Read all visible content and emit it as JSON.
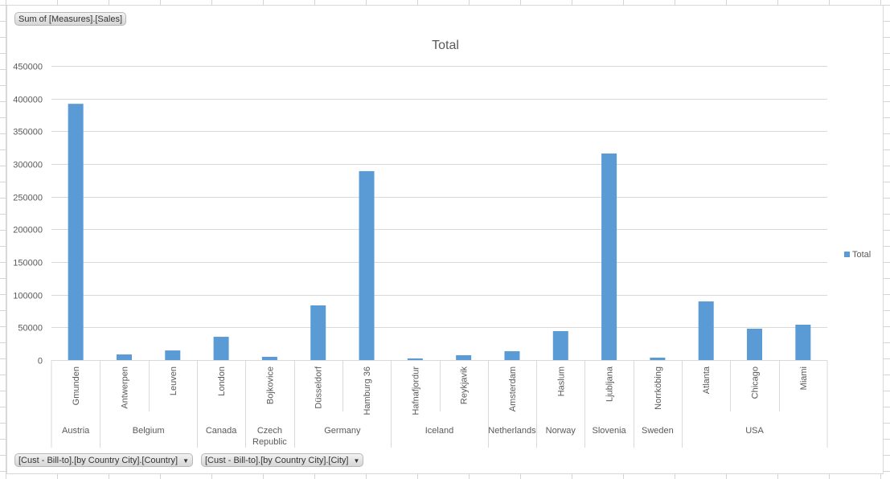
{
  "field_buttons": {
    "values": "Sum of [Measures].[Sales]",
    "axis_country": "[Cust - Bill-to].[by Country City].[Country]",
    "axis_city": "[Cust - Bill-to].[by Country City].[City]"
  },
  "icons": {
    "dropdown": "chevron-down-icon"
  },
  "colors": {
    "bar": "#5b9bd5",
    "grid": "#d9d9d9",
    "text": "#595959"
  },
  "chart_data": {
    "type": "bar",
    "title": "Total",
    "xlabel": "",
    "ylabel": "",
    "ylim": [
      0,
      450000
    ],
    "yticks": [
      0,
      50000,
      100000,
      150000,
      200000,
      250000,
      300000,
      350000,
      400000,
      450000
    ],
    "grid": true,
    "legend": {
      "position": "right",
      "entries": [
        "Total"
      ]
    },
    "categories": [
      "Gmunden",
      "Antwerpen",
      "Leuven",
      "London",
      "Bojkovice",
      "Düsseldorf",
      "Hamburg 36",
      "Hafnafjordur",
      "Reykjavik",
      "Amsterdam",
      "Haslum",
      "Ljubljana",
      "Norrköbing",
      "Atlanta",
      "Chicago",
      "Miami"
    ],
    "groups": [
      {
        "name": "Austria",
        "count": 1
      },
      {
        "name": "Belgium",
        "count": 2
      },
      {
        "name": "Canada",
        "count": 1
      },
      {
        "name": "Czech Republic",
        "count": 1
      },
      {
        "name": "Germany",
        "count": 2
      },
      {
        "name": "Iceland",
        "count": 2
      },
      {
        "name": "Netherlands",
        "count": 1
      },
      {
        "name": "Norway",
        "count": 1
      },
      {
        "name": "Slovenia",
        "count": 1
      },
      {
        "name": "Sweden",
        "count": 1
      },
      {
        "name": "USA",
        "count": 3
      }
    ],
    "series": [
      {
        "name": "Total",
        "values": [
          392000,
          8600,
          14700,
          35600,
          5000,
          83600,
          289000,
          2500,
          7400,
          13500,
          44300,
          316000,
          3700,
          89700,
          48000,
          54100
        ]
      }
    ]
  }
}
